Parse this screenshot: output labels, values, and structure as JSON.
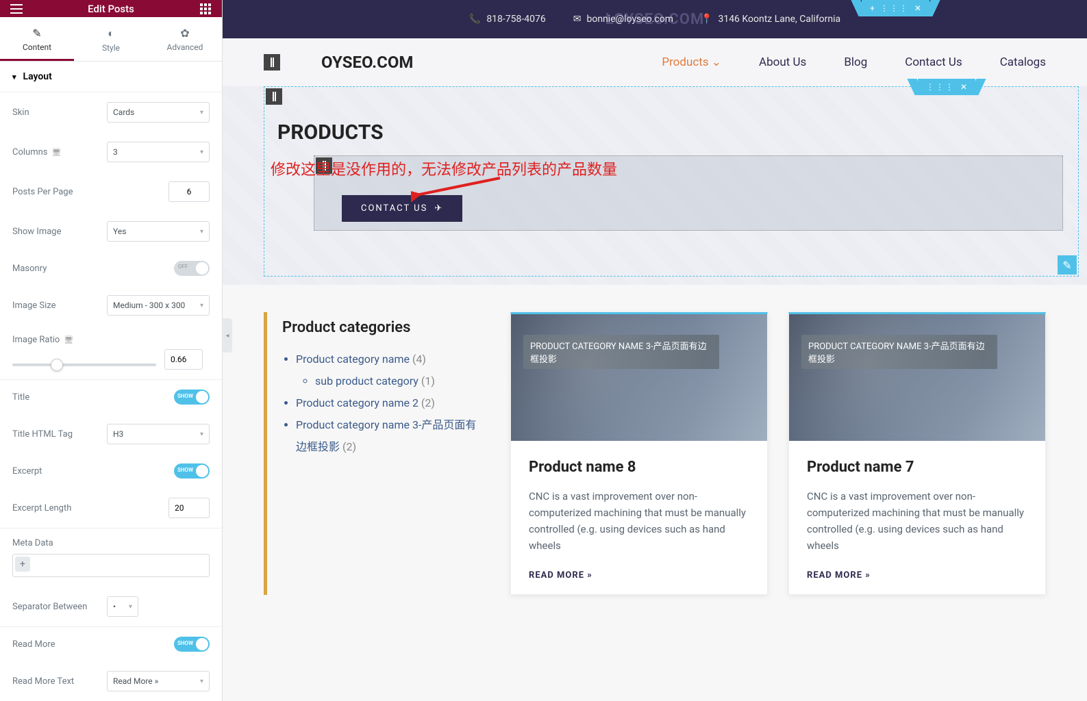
{
  "panel": {
    "title": "Edit Posts",
    "tabs": {
      "content": "Content",
      "style": "Style",
      "advanced": "Advanced"
    },
    "section": "Layout",
    "fields": {
      "skin": {
        "label": "Skin",
        "value": "Cards"
      },
      "columns": {
        "label": "Columns",
        "value": "3"
      },
      "posts_per_page": {
        "label": "Posts Per Page",
        "value": "6"
      },
      "show_image": {
        "label": "Show Image",
        "value": "Yes"
      },
      "masonry": {
        "label": "Masonry",
        "value": "OFF"
      },
      "image_size": {
        "label": "Image Size",
        "value": "Medium - 300 x 300"
      },
      "image_ratio": {
        "label": "Image Ratio",
        "value": "0.66"
      },
      "title": {
        "label": "Title",
        "value": "SHOW"
      },
      "title_html_tag": {
        "label": "Title HTML Tag",
        "value": "H3"
      },
      "excerpt": {
        "label": "Excerpt",
        "value": "SHOW"
      },
      "excerpt_length": {
        "label": "Excerpt Length",
        "value": "20"
      },
      "meta_data": {
        "label": "Meta Data"
      },
      "separator_between": {
        "label": "Separator Between",
        "value": "•"
      },
      "read_more": {
        "label": "Read More",
        "value": "SHOW"
      },
      "read_more_text": {
        "label": "Read More Text",
        "value": "Read More »"
      }
    }
  },
  "annotation": "修改这里是没作用的，无法修改产品列表的产品数量",
  "preview": {
    "topbar": {
      "phone": "818-758-4076",
      "email": "bonnie@loyseo.com",
      "address": "3146 Koontz Lane, California",
      "watermark": "LOYSEO.COM"
    },
    "nav": {
      "logo": "OYSEO.COM",
      "links": [
        "Products",
        "About Us",
        "Blog",
        "Contact Us",
        "Catalogs"
      ]
    },
    "hero": {
      "title": "PRODUCTS",
      "cta": "CONTACT US"
    },
    "categories": {
      "heading": "Product categories",
      "items": [
        {
          "name": "Product category name",
          "count": "(4)",
          "children": [
            {
              "name": "sub product category",
              "count": "(1)"
            }
          ]
        },
        {
          "name": "Product category name 2",
          "count": "(2)"
        },
        {
          "name": "Product category name 3-产品页面有边框投影",
          "count": "(2)"
        }
      ]
    },
    "products": [
      {
        "badge": "PRODUCT CATEGORY NAME 3-产品页面有边框投影",
        "title": "Product name 8",
        "excerpt": "CNC is a vast improvement over non-computerized machining that must be manually controlled (e.g. using devices such as hand wheels",
        "readmore": "READ MORE »"
      },
      {
        "badge": "PRODUCT CATEGORY NAME 3-产品页面有边框投影",
        "title": "Product name 7",
        "excerpt": "CNC is a vast improvement over non-computerized machining that must be manually controlled (e.g. using devices such as hand wheels",
        "readmore": "READ MORE »"
      }
    ]
  }
}
